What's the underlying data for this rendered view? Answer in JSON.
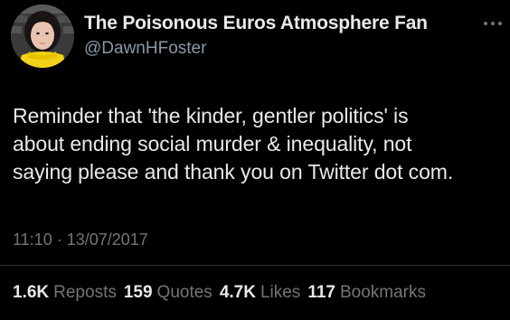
{
  "author": {
    "display_name": "The Poisonous Euros Atmosphere Fan",
    "handle": "@DawnHFoster",
    "avatar_icon": "profile-photo"
  },
  "more_icon": "more-horizontal-icon",
  "tweet": {
    "text_lines": [
      "Reminder that 'the kinder, gentler politics' is",
      "about ending social murder & inequality, not",
      "saying please and thank you on Twitter dot com."
    ],
    "timestamp": "11:10 · 13/07/2017"
  },
  "stats": {
    "reposts": {
      "count": "1.6K",
      "label": "Reposts"
    },
    "quotes": {
      "count": "159",
      "label": "Quotes"
    },
    "likes": {
      "count": "4.7K",
      "label": "Likes"
    },
    "bookmarks": {
      "count": "117",
      "label": "Bookmarks"
    }
  },
  "colors": {
    "background": "#000000",
    "primary_text": "#e7e9ea",
    "secondary_text": "#71767b",
    "divider": "#2f3336"
  }
}
